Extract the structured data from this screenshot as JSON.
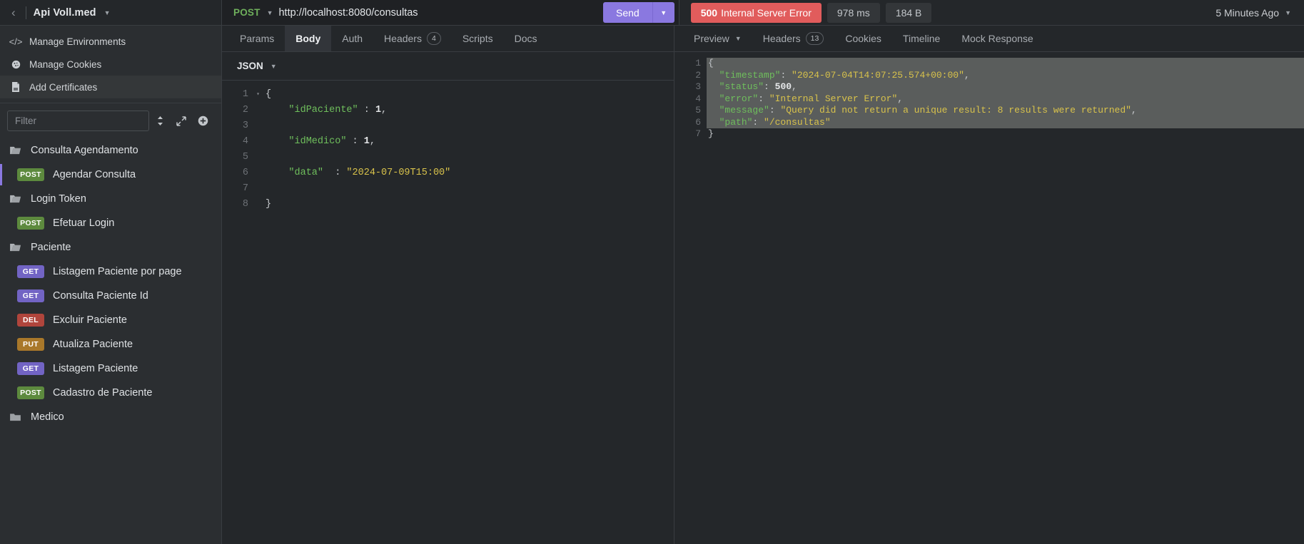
{
  "topbar": {
    "back_icon": "chevron-left-icon",
    "workspace_name": "Api Voll.med",
    "workspace_caret": "▼",
    "method": "POST",
    "method_caret": "▼",
    "url": "http://localhost:8080/consultas",
    "send_label": "Send",
    "send_caret": "▼",
    "status_code": "500",
    "status_text": "Internal Server Error",
    "time": "978 ms",
    "size": "184 B",
    "history_label": "5 Minutes Ago",
    "history_caret": "▼",
    "accent_color": "#8a78e0",
    "error_color": "#e15c5c"
  },
  "sidebar": {
    "actions": [
      {
        "label": "Manage Environments",
        "icon": "code-brackets-icon",
        "glyph": "</>",
        "highlighted": false
      },
      {
        "label": "Manage Cookies",
        "icon": "cookie-icon",
        "glyph": "🍪",
        "highlighted": false
      },
      {
        "label": "Add Certificates",
        "icon": "certificate-icon",
        "glyph": "📄",
        "highlighted": true
      }
    ],
    "filter": {
      "placeholder": "Filter",
      "sort_icon": "sort-updown-icon",
      "expand_icon": "expand-arrows-icon",
      "add_icon": "plus-circle-icon"
    },
    "tree": [
      {
        "type": "folder",
        "label": "Consulta Agendamento",
        "icon": "folder-open-icon"
      },
      {
        "type": "request",
        "method": "POST",
        "label": "Agendar Consulta",
        "active": true
      },
      {
        "type": "folder",
        "label": "Login Token",
        "icon": "folder-open-icon"
      },
      {
        "type": "request",
        "method": "POST",
        "label": "Efetuar Login",
        "active": false
      },
      {
        "type": "folder",
        "label": "Paciente",
        "icon": "folder-open-icon"
      },
      {
        "type": "request",
        "method": "GET",
        "label": "Listagem Paciente por page",
        "active": false
      },
      {
        "type": "request",
        "method": "GET",
        "label": "Consulta Paciente Id",
        "active": false
      },
      {
        "type": "request",
        "method": "DEL",
        "label": "Excluir Paciente",
        "active": false
      },
      {
        "type": "request",
        "method": "PUT",
        "label": "Atualiza Paciente",
        "active": false
      },
      {
        "type": "request",
        "method": "GET",
        "label": "Listagem Paciente",
        "active": false
      },
      {
        "type": "request",
        "method": "POST",
        "label": "Cadastro de Paciente",
        "active": false
      },
      {
        "type": "folder",
        "label": "Medico",
        "icon": "folder-closed-icon"
      }
    ]
  },
  "request": {
    "tabs": [
      {
        "label": "Params",
        "badge": null,
        "active": false
      },
      {
        "label": "Body",
        "badge": null,
        "active": true
      },
      {
        "label": "Auth",
        "badge": null,
        "active": false
      },
      {
        "label": "Headers",
        "badge": "4",
        "active": false
      },
      {
        "label": "Scripts",
        "badge": null,
        "active": false
      },
      {
        "label": "Docs",
        "badge": null,
        "active": false
      }
    ],
    "body_format": "JSON",
    "body_format_caret": "▼",
    "lines": [
      {
        "no": "1",
        "fold": "▾"
      },
      {
        "no": "2",
        "fold": ""
      },
      {
        "no": "3",
        "fold": ""
      },
      {
        "no": "4",
        "fold": ""
      },
      {
        "no": "5",
        "fold": ""
      },
      {
        "no": "6",
        "fold": ""
      },
      {
        "no": "7",
        "fold": ""
      },
      {
        "no": "8",
        "fold": ""
      }
    ],
    "code": {
      "l1": "{",
      "l2_key": "\"idPaciente\"",
      "l2_mid": " : ",
      "l2_val": "1",
      "l2_end": ",",
      "l4_key": "\"idMedico\"",
      "l4_mid": " : ",
      "l4_val": "1",
      "l4_end": ",",
      "l6_key": "\"data\"",
      "l6_mid": "  : ",
      "l6_val": "\"2024-07-09T15:00\"",
      "l8": "}"
    }
  },
  "response": {
    "tabs": [
      {
        "label": "Preview",
        "caret": "▼",
        "badge": null,
        "active": false
      },
      {
        "label": "Headers",
        "caret": null,
        "badge": "13",
        "active": false
      },
      {
        "label": "Cookies",
        "caret": null,
        "badge": null,
        "active": false
      },
      {
        "label": "Timeline",
        "caret": null,
        "badge": null,
        "active": false
      },
      {
        "label": "Mock Response",
        "caret": null,
        "badge": null,
        "active": false
      }
    ],
    "lines": [
      {
        "no": "1",
        "fold": "▾"
      },
      {
        "no": "2",
        "fold": ""
      },
      {
        "no": "3",
        "fold": ""
      },
      {
        "no": "4",
        "fold": ""
      },
      {
        "no": "5",
        "fold": ""
      },
      {
        "no": "6",
        "fold": ""
      },
      {
        "no": "7",
        "fold": ""
      }
    ],
    "code": {
      "l1": "{",
      "l2_key": "\"timestamp\"",
      "l2_sep": ": ",
      "l2_val": "\"2024-07-04T14:07:25.574+00:00\"",
      "l2_end": ",",
      "l3_key": "\"status\"",
      "l3_sep": ": ",
      "l3_val": "500",
      "l3_end": ",",
      "l4_key": "\"error\"",
      "l4_sep": ": ",
      "l4_val": "\"Internal Server Error\"",
      "l4_end": ",",
      "l5_key": "\"message\"",
      "l5_sep": ": ",
      "l5_val": "\"Query did not return a unique result: 8 results were returned\"",
      "l5_end": ",",
      "l6_key": "\"path\"",
      "l6_sep": ": ",
      "l6_val": "\"/consultas\"",
      "l6_end": "",
      "l7": "}"
    }
  }
}
